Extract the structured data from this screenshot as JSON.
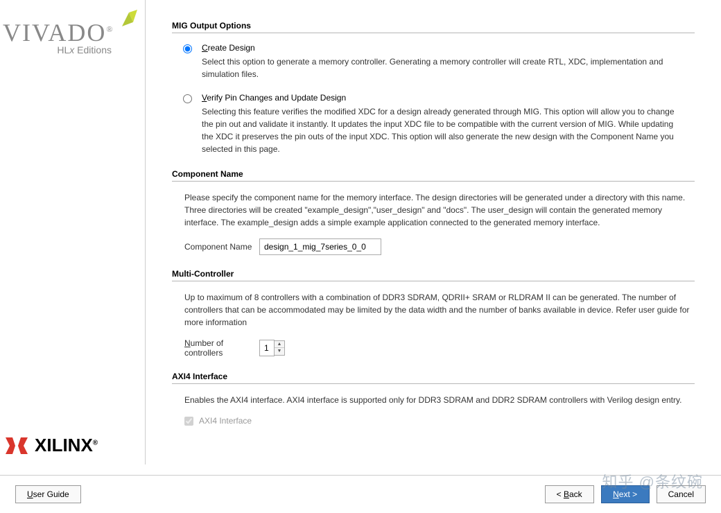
{
  "sidebar": {
    "product": "VIVADO",
    "edition": "HLx Editions",
    "vendor": "XILINX"
  },
  "sections": {
    "mig": {
      "title": "MIG Output Options",
      "create": {
        "label": "Create Design",
        "mnemonic_pos": 0,
        "desc": "Select this option to generate a memory controller. Generating a memory controller will create RTL, XDC, implementation and simulation files."
      },
      "verify": {
        "label": "Verify Pin Changes and Update Design",
        "mnemonic_pos": 0,
        "desc": "Selecting this feature verifies the modified XDC for a design already generated through MIG. This option will allow you to change the pin out and validate it instantly. It updates the input XDC file to be compatible with the current version of MIG. While updating the XDC it preserves the pin outs of the input XDC. This option will also generate the new design with the Component Name you selected in this page."
      },
      "selected": "create"
    },
    "component": {
      "title": "Component Name",
      "desc": "Please specify the component name for the memory interface. The design directories will be generated under a directory with this name. Three directories will be created \"example_design\",\"user_design\" and \"docs\". The user_design will contain the generated memory interface. The example_design adds a simple example application connected to the generated memory interface.",
      "label": "Component Name",
      "value": "design_1_mig_7series_0_0"
    },
    "multi": {
      "title": "Multi-Controller",
      "desc": "Up to maximum of 8 controllers with a combination of DDR3 SDRAM, QDRII+ SRAM or RLDRAM II can be generated. The number of controllers that can be accommodated may be limited by the data width and the number of banks available in device. Refer user guide for more information",
      "label": "Number of controllers",
      "value": "1"
    },
    "axi": {
      "title": "AXI4 Interface",
      "desc": "Enables the AXI4 interface. AXI4 interface is supported only for DDR3 SDRAM and DDR2 SDRAM controllers with Verilog design entry.",
      "checkbox_label": "AXI4 Interface",
      "checked": true
    }
  },
  "footer": {
    "user_guide": "User Guide",
    "back": "Back",
    "next": "Next",
    "cancel": "Cancel"
  },
  "watermark": "知乎 @条纹碗"
}
